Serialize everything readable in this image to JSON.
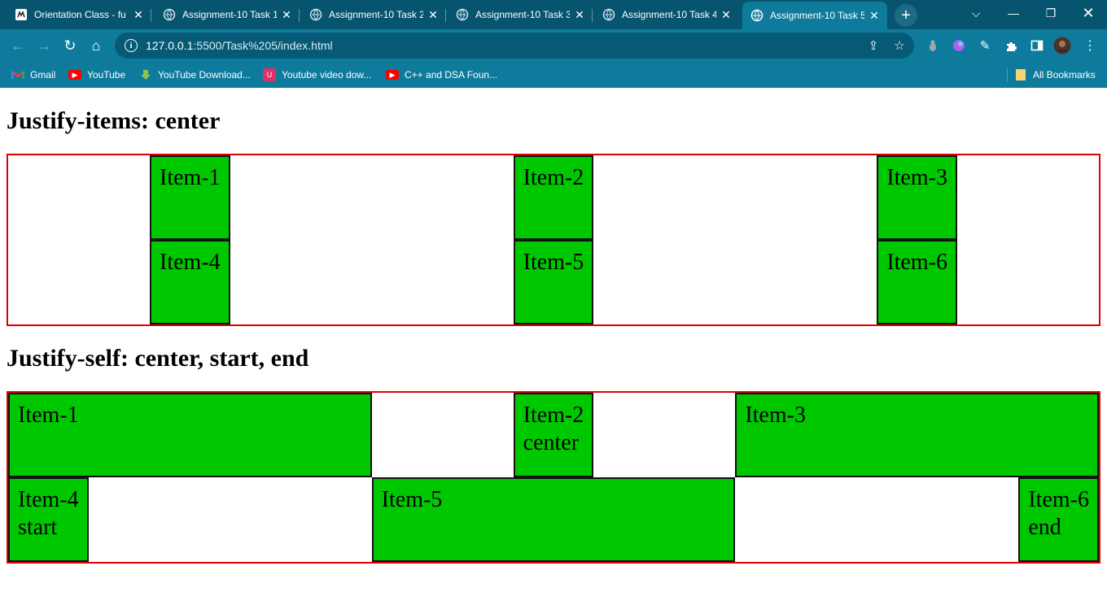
{
  "browser": {
    "tabs": [
      {
        "title": "Orientation Class - fu",
        "active": false
      },
      {
        "title": "Assignment-10 Task 1",
        "active": false
      },
      {
        "title": "Assignment-10 Task 2",
        "active": false
      },
      {
        "title": "Assignment-10 Task 3",
        "active": false
      },
      {
        "title": "Assignment-10 Task 4",
        "active": false
      },
      {
        "title": "Assignment-10 Task 5",
        "active": true
      }
    ],
    "url_host": "127.0.0.1",
    "url_rest": ":5500/Task%205/index.html",
    "bookmarks": [
      {
        "label": "Gmail",
        "icon": "gmail-icon"
      },
      {
        "label": "YouTube",
        "icon": "youtube-icon"
      },
      {
        "label": "YouTube Download...",
        "icon": "download-icon"
      },
      {
        "label": "Youtube video dow...",
        "icon": "video-download-icon"
      },
      {
        "label": "C++ and DSA Foun...",
        "icon": "youtube-icon"
      }
    ],
    "all_bookmarks": "All Bookmarks",
    "colors": {
      "chrome": "#0e7b9c",
      "tabstrip": "#07546f"
    }
  },
  "page": {
    "section1": {
      "heading": "Justify-items: center",
      "items": [
        "Item-1",
        "Item-2",
        "Item-3",
        "Item-4",
        "Item-5",
        "Item-6"
      ]
    },
    "section2": {
      "heading": "Justify-self: center, start, end",
      "items": [
        {
          "text": "Item-1"
        },
        {
          "text": "Item-2\ncenter"
        },
        {
          "text": "Item-3"
        },
        {
          "text": "Item-4\nstart"
        },
        {
          "text": "Item-5"
        },
        {
          "text": "Item-6\nend"
        }
      ]
    },
    "colors": {
      "item_bg": "#00c800",
      "grid_border": "#e00000"
    }
  }
}
